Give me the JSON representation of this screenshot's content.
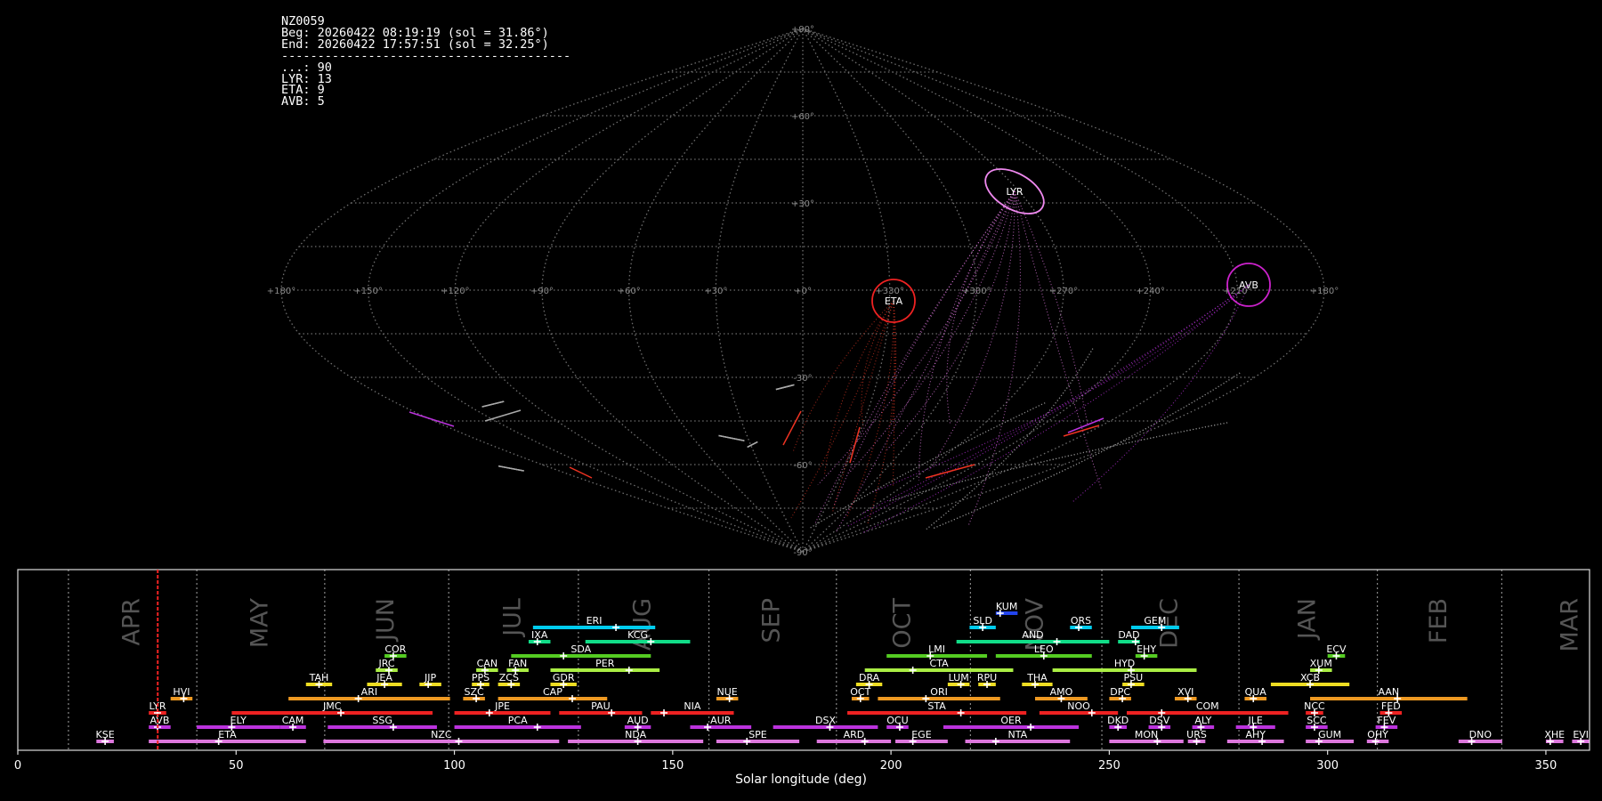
{
  "info": {
    "station": "NZ0059",
    "begin": "Beg: 20260422 08:19:19 (sol = 31.86°)",
    "end": "End: 20260422 17:57:51 (sol = 32.25°)",
    "separator": "----------------------------------------",
    "counts": [
      "...: 90",
      "LYR: 13",
      "ETA: 9",
      "AVB: 5"
    ]
  },
  "skymap": {
    "projection": "sinusoidal",
    "lon_labels": [
      "+180°",
      "+150°",
      "+120°",
      "+90°",
      "+60°",
      "+30°",
      "+0°",
      "+330°",
      "+300°",
      "+270°",
      "+240°",
      "+210°",
      "+180°"
    ],
    "lat_labels": [
      "+90°",
      "+60°",
      "+30°",
      "-30°",
      "-60°",
      "-90°"
    ],
    "grid_color": "#6e6e6e",
    "radiants": [
      {
        "code": "LYR",
        "color": "#ee88ee"
      },
      {
        "code": "ETA",
        "color": "#ee2222"
      },
      {
        "code": "AVB",
        "color": "#cc22cc"
      }
    ]
  },
  "chart_data": {
    "type": "timeline",
    "title": "",
    "xlabel": "Solar longitude (deg)",
    "xlim": [
      0,
      360
    ],
    "xticks": [
      0,
      50,
      100,
      150,
      200,
      250,
      300,
      350
    ],
    "current_sol": 32.05,
    "months": [
      {
        "label": "APR",
        "start": 11.6
      },
      {
        "label": "MAY",
        "start": 41.0
      },
      {
        "label": "JUN",
        "start": 70.3
      },
      {
        "label": "JUL",
        "start": 98.7
      },
      {
        "label": "AUG",
        "start": 128.4
      },
      {
        "label": "SEP",
        "start": 158.3
      },
      {
        "label": "OCT",
        "start": 187.5
      },
      {
        "label": "NOV",
        "start": 218.2
      },
      {
        "label": "DEC",
        "start": 248.3
      },
      {
        "label": "JAN",
        "start": 279.7
      },
      {
        "label": "FEB",
        "start": 311.4
      },
      {
        "label": "MAR",
        "start": 339.9
      }
    ],
    "showers": [
      {
        "code": "KUM",
        "start": 224,
        "end": 229,
        "peak": 225,
        "row": 9,
        "color": "#2244ee"
      },
      {
        "code": "ERI",
        "start": 118,
        "end": 146,
        "peak": 137,
        "row": 8,
        "color": "#00ccee"
      },
      {
        "code": "SLD",
        "start": 218,
        "end": 224,
        "peak": 221,
        "row": 8,
        "color": "#00ccee"
      },
      {
        "code": "ORS",
        "start": 241,
        "end": 246,
        "peak": 243,
        "row": 8,
        "color": "#00ccee"
      },
      {
        "code": "GEM",
        "start": 255,
        "end": 266,
        "peak": 262,
        "row": 8,
        "color": "#00ccee"
      },
      {
        "code": "IXA",
        "start": 117,
        "end": 122,
        "peak": 119,
        "row": 7,
        "color": "#11dd88"
      },
      {
        "code": "KCG",
        "start": 130,
        "end": 154,
        "peak": 145,
        "row": 7,
        "color": "#11dd88"
      },
      {
        "code": "AND",
        "start": 215,
        "end": 250,
        "peak": 238,
        "row": 7,
        "color": "#11dd88"
      },
      {
        "code": "DAD",
        "start": 252,
        "end": 257,
        "peak": 256,
        "row": 7,
        "color": "#11dd88"
      },
      {
        "code": "COR",
        "start": 84,
        "end": 89,
        "peak": 86,
        "row": 6,
        "color": "#55cc22"
      },
      {
        "code": "SDA",
        "start": 113,
        "end": 145,
        "peak": 125,
        "row": 6,
        "color": "#55cc22"
      },
      {
        "code": "LMI",
        "start": 199,
        "end": 222,
        "peak": 209,
        "row": 6,
        "color": "#55cc22"
      },
      {
        "code": "LEO",
        "start": 224,
        "end": 246,
        "peak": 235,
        "row": 6,
        "color": "#55cc22"
      },
      {
        "code": "EHY",
        "start": 256,
        "end": 261,
        "peak": 258,
        "row": 6,
        "color": "#55cc22"
      },
      {
        "code": "ECV",
        "start": 300,
        "end": 304,
        "peak": 302,
        "row": 6,
        "color": "#55cc22"
      },
      {
        "code": "JRC",
        "start": 82,
        "end": 87,
        "peak": 85,
        "row": 5,
        "color": "#aaee44"
      },
      {
        "code": "CAN",
        "start": 105,
        "end": 110,
        "peak": 107,
        "row": 5,
        "color": "#aaee44"
      },
      {
        "code": "FAN",
        "start": 112,
        "end": 117,
        "peak": 114,
        "row": 5,
        "color": "#aaee44"
      },
      {
        "code": "PER",
        "start": 122,
        "end": 147,
        "peak": 140,
        "row": 5,
        "color": "#aaee44"
      },
      {
        "code": "CTA",
        "start": 194,
        "end": 228,
        "peak": 205,
        "row": 5,
        "color": "#aaee44"
      },
      {
        "code": "HYD",
        "start": 237,
        "end": 270,
        "peak": 255,
        "row": 5,
        "color": "#aaee44"
      },
      {
        "code": "XUM",
        "start": 296,
        "end": 301,
        "peak": 298,
        "row": 5,
        "color": "#aaee44"
      },
      {
        "code": "TAH",
        "start": 66,
        "end": 72,
        "peak": 69,
        "row": 4,
        "color": "#eedd22"
      },
      {
        "code": "JEA",
        "start": 80,
        "end": 88,
        "peak": 84,
        "row": 4,
        "color": "#eedd22"
      },
      {
        "code": "JIP",
        "start": 92,
        "end": 97,
        "peak": 94,
        "row": 4,
        "color": "#eedd22"
      },
      {
        "code": "PPS",
        "start": 104,
        "end": 108,
        "peak": 106,
        "row": 4,
        "color": "#eedd22"
      },
      {
        "code": "ZCS",
        "start": 110,
        "end": 115,
        "peak": 113,
        "row": 4,
        "color": "#eedd22"
      },
      {
        "code": "GDR",
        "start": 122,
        "end": 128,
        "peak": 125,
        "row": 4,
        "color": "#eedd22"
      },
      {
        "code": "DRA",
        "start": 192,
        "end": 198,
        "peak": 195,
        "row": 4,
        "color": "#eedd22"
      },
      {
        "code": "LUM",
        "start": 213,
        "end": 218,
        "peak": 216,
        "row": 4,
        "color": "#eedd22"
      },
      {
        "code": "RPU",
        "start": 220,
        "end": 224,
        "peak": 222,
        "row": 4,
        "color": "#eedd22"
      },
      {
        "code": "THA",
        "start": 230,
        "end": 237,
        "peak": 233,
        "row": 4,
        "color": "#eedd22"
      },
      {
        "code": "PSU",
        "start": 253,
        "end": 258,
        "peak": 255,
        "row": 4,
        "color": "#eedd22"
      },
      {
        "code": "XCB",
        "start": 287,
        "end": 305,
        "peak": 296,
        "row": 4,
        "color": "#eedd22"
      },
      {
        "code": "HVI",
        "start": 35,
        "end": 40,
        "peak": 38,
        "row": 3,
        "color": "#ee9922"
      },
      {
        "code": "ARI",
        "start": 62,
        "end": 99,
        "peak": 78,
        "row": 3,
        "color": "#ee9922"
      },
      {
        "code": "SZC",
        "start": 102,
        "end": 107,
        "peak": 105,
        "row": 3,
        "color": "#ee9922"
      },
      {
        "code": "CAP",
        "start": 110,
        "end": 135,
        "peak": 127,
        "row": 3,
        "color": "#ee9922"
      },
      {
        "code": "NUE",
        "start": 160,
        "end": 165,
        "peak": 163,
        "row": 3,
        "color": "#ee9922"
      },
      {
        "code": "OCT",
        "start": 191,
        "end": 195,
        "peak": 193,
        "row": 3,
        "color": "#ee9922"
      },
      {
        "code": "ORI",
        "start": 197,
        "end": 225,
        "peak": 208,
        "row": 3,
        "color": "#ee9922"
      },
      {
        "code": "AMO",
        "start": 233,
        "end": 245,
        "peak": 239,
        "row": 3,
        "color": "#ee9922"
      },
      {
        "code": "DPC",
        "start": 250,
        "end": 255,
        "peak": 253,
        "row": 3,
        "color": "#ee9922"
      },
      {
        "code": "XVI",
        "start": 265,
        "end": 270,
        "peak": 268,
        "row": 3,
        "color": "#ee9922"
      },
      {
        "code": "QUA",
        "start": 281,
        "end": 286,
        "peak": 283,
        "row": 3,
        "color": "#ee9922"
      },
      {
        "code": "AAN",
        "start": 296,
        "end": 332,
        "peak": 316,
        "row": 3,
        "color": "#ee9922"
      },
      {
        "code": "LYR",
        "start": 30,
        "end": 34,
        "peak": 32,
        "row": 2,
        "color": "#ee2222"
      },
      {
        "code": "JMC",
        "start": 49,
        "end": 95,
        "peak": 74,
        "row": 2,
        "color": "#ee2222"
      },
      {
        "code": "JPE",
        "start": 100,
        "end": 122,
        "peak": 108,
        "row": 2,
        "color": "#ee2222"
      },
      {
        "code": "PAU",
        "start": 124,
        "end": 143,
        "peak": 136,
        "row": 2,
        "color": "#ee2222"
      },
      {
        "code": "NIA",
        "start": 145,
        "end": 164,
        "peak": 148,
        "row": 2,
        "color": "#ee2222"
      },
      {
        "code": "STA",
        "start": 190,
        "end": 231,
        "peak": 216,
        "row": 2,
        "color": "#ee2222"
      },
      {
        "code": "NOO",
        "start": 234,
        "end": 252,
        "peak": 246,
        "row": 2,
        "color": "#ee2222"
      },
      {
        "code": "COM",
        "start": 254,
        "end": 291,
        "peak": 262,
        "row": 2,
        "color": "#ee2222"
      },
      {
        "code": "NCC",
        "start": 295,
        "end": 299,
        "peak": 297,
        "row": 2,
        "color": "#ee2222"
      },
      {
        "code": "FED",
        "start": 312,
        "end": 317,
        "peak": 314,
        "row": 2,
        "color": "#ee2222"
      },
      {
        "code": "AVB",
        "start": 30,
        "end": 35,
        "peak": 32,
        "row": 1,
        "color": "#bb33dd"
      },
      {
        "code": "ELY",
        "start": 41,
        "end": 60,
        "peak": 49,
        "row": 1,
        "color": "#bb33dd"
      },
      {
        "code": "CAM",
        "start": 60,
        "end": 66,
        "peak": 63,
        "row": 1,
        "color": "#bb33dd"
      },
      {
        "code": "SSG",
        "start": 71,
        "end": 96,
        "peak": 86,
        "row": 1,
        "color": "#bb33dd"
      },
      {
        "code": "PCA",
        "start": 100,
        "end": 129,
        "peak": 119,
        "row": 1,
        "color": "#bb33dd"
      },
      {
        "code": "AUD",
        "start": 139,
        "end": 145,
        "peak": 142,
        "row": 1,
        "color": "#bb33dd"
      },
      {
        "code": "AUR",
        "start": 154,
        "end": 168,
        "peak": 158,
        "row": 1,
        "color": "#bb33dd"
      },
      {
        "code": "DSX",
        "start": 173,
        "end": 197,
        "peak": 186,
        "row": 1,
        "color": "#bb33dd"
      },
      {
        "code": "OCU",
        "start": 199,
        "end": 204,
        "peak": 202,
        "row": 1,
        "color": "#bb33dd"
      },
      {
        "code": "OER",
        "start": 212,
        "end": 243,
        "peak": 232,
        "row": 1,
        "color": "#bb33dd"
      },
      {
        "code": "DKD",
        "start": 250,
        "end": 254,
        "peak": 252,
        "row": 1,
        "color": "#bb33dd"
      },
      {
        "code": "DSV",
        "start": 259,
        "end": 264,
        "peak": 262,
        "row": 1,
        "color": "#bb33dd"
      },
      {
        "code": "ALY",
        "start": 269,
        "end": 274,
        "peak": 271,
        "row": 1,
        "color": "#bb33dd"
      },
      {
        "code": "JLE",
        "start": 279,
        "end": 288,
        "peak": 283,
        "row": 1,
        "color": "#bb33dd"
      },
      {
        "code": "SCC",
        "start": 295,
        "end": 300,
        "peak": 297,
        "row": 1,
        "color": "#bb33dd"
      },
      {
        "code": "FEV",
        "start": 311,
        "end": 316,
        "peak": 313,
        "row": 1,
        "color": "#bb33dd"
      },
      {
        "code": "KSE",
        "start": 18,
        "end": 22,
        "peak": 20,
        "row": 0,
        "color": "#dd77dd"
      },
      {
        "code": "ETA",
        "start": 30,
        "end": 66,
        "peak": 46,
        "row": 0,
        "color": "#dd77dd"
      },
      {
        "code": "NZC",
        "start": 70,
        "end": 124,
        "peak": 101,
        "row": 0,
        "color": "#dd77dd"
      },
      {
        "code": "NDA",
        "start": 126,
        "end": 157,
        "peak": 142,
        "row": 0,
        "color": "#dd77dd"
      },
      {
        "code": "SPE",
        "start": 160,
        "end": 179,
        "peak": 167,
        "row": 0,
        "color": "#dd77dd"
      },
      {
        "code": "ARD",
        "start": 183,
        "end": 200,
        "peak": 194,
        "row": 0,
        "color": "#dd77dd"
      },
      {
        "code": "EGE",
        "start": 201,
        "end": 213,
        "peak": 205,
        "row": 0,
        "color": "#dd77dd"
      },
      {
        "code": "NTA",
        "start": 217,
        "end": 241,
        "peak": 224,
        "row": 0,
        "color": "#dd77dd"
      },
      {
        "code": "MON",
        "start": 250,
        "end": 267,
        "peak": 261,
        "row": 0,
        "color": "#dd77dd"
      },
      {
        "code": "URS",
        "start": 268,
        "end": 272,
        "peak": 270,
        "row": 0,
        "color": "#dd77dd"
      },
      {
        "code": "AHY",
        "start": 277,
        "end": 290,
        "peak": 285,
        "row": 0,
        "color": "#dd77dd"
      },
      {
        "code": "GUM",
        "start": 295,
        "end": 306,
        "peak": 298,
        "row": 0,
        "color": "#dd77dd"
      },
      {
        "code": "OHY",
        "start": 309,
        "end": 314,
        "peak": 311,
        "row": 0,
        "color": "#dd77dd"
      },
      {
        "code": "DNO",
        "start": 330,
        "end": 340,
        "peak": 333,
        "row": 0,
        "color": "#dd77dd"
      },
      {
        "code": "XHE",
        "start": 350,
        "end": 354,
        "peak": 351,
        "row": 0,
        "color": "#dd77dd"
      },
      {
        "code": "EVI",
        "start": 356,
        "end": 360,
        "peak": 358,
        "row": 0,
        "color": "#dd77dd"
      }
    ]
  }
}
